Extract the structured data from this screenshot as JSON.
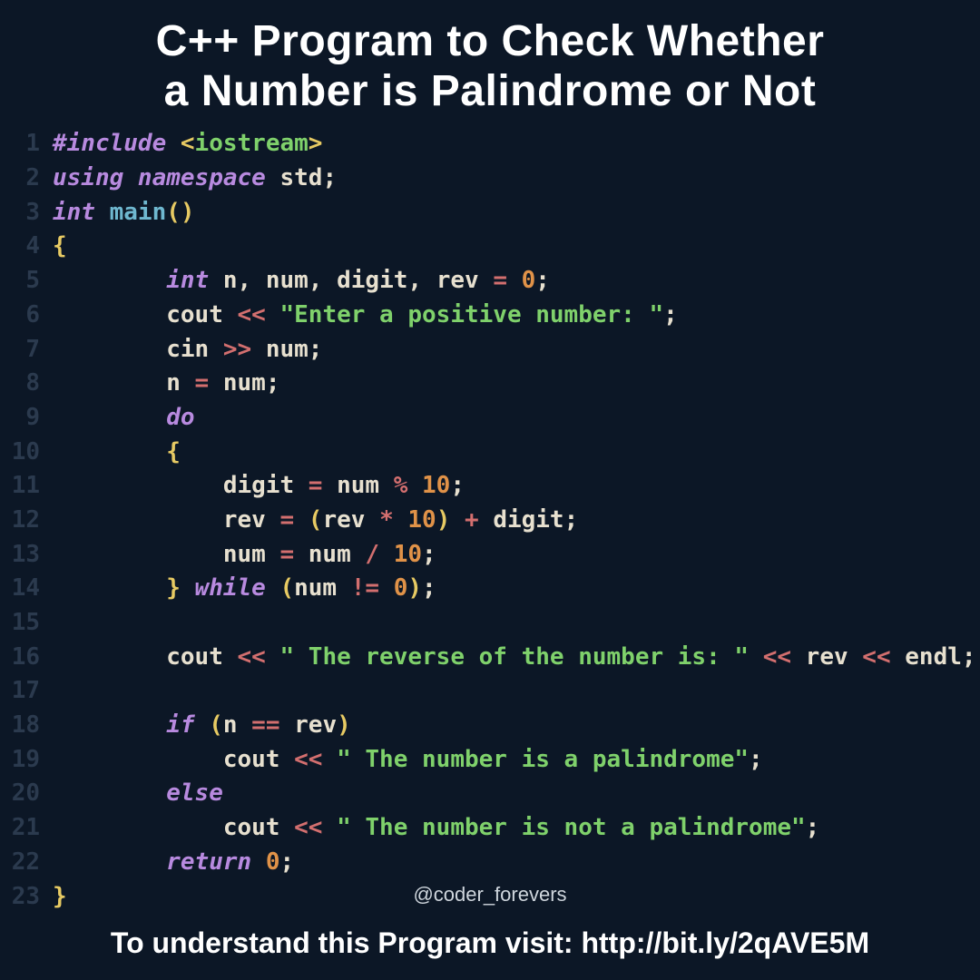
{
  "title_line1": "C++ Program to Check Whether",
  "title_line2": "a Number is Palindrome or Not",
  "watermark": "@coder_forevers",
  "footer": "To understand this Program visit: http://bit.ly/2qAVE5M",
  "code": {
    "line_numbers": [
      "1",
      "2",
      "3",
      "4",
      "5",
      "6",
      "7",
      "8",
      "9",
      "10",
      "11",
      "12",
      "13",
      "14",
      "15",
      "16",
      "17",
      "18",
      "19",
      "20",
      "21",
      "22",
      "23"
    ],
    "l1": {
      "hash_include": "#include ",
      "lt": "<",
      "hdr": "iostream",
      "gt": ">"
    },
    "l2": {
      "using": "using ",
      "namespace": "namespace ",
      "std": "std",
      "semi": ";"
    },
    "l3": {
      "int": "int ",
      "main": "main",
      "lp": "(",
      "rp": ")"
    },
    "l4": {
      "lb": "{"
    },
    "l5": {
      "indent": "        ",
      "int": "int ",
      "n": "n",
      "c1": ", ",
      "num": "num",
      "c2": ", ",
      "digit": "digit",
      "c3": ", ",
      "rev": "rev ",
      "eq": "= ",
      "zero": "0",
      "semi": ";"
    },
    "l6": {
      "indent": "        ",
      "cout": "cout ",
      "ins": "<< ",
      "str": "\"Enter a positive number: \"",
      "semi": ";"
    },
    "l7": {
      "indent": "        ",
      "cin": "cin ",
      "ext": ">> ",
      "num": "num",
      "semi": ";"
    },
    "l8": {
      "indent": "        ",
      "n": "n ",
      "eq": "= ",
      "num": "num",
      "semi": ";"
    },
    "l9": {
      "indent": "        ",
      "do": "do"
    },
    "l10": {
      "indent": "        ",
      "lb": "{"
    },
    "l11": {
      "indent": "            ",
      "digit": "digit ",
      "eq": "= ",
      "num": "num ",
      "mod": "% ",
      "ten": "10",
      "semi": ";"
    },
    "l12": {
      "indent": "            ",
      "rev": "rev ",
      "eq": "= ",
      "lp": "(",
      "rev2": "rev ",
      "mul": "* ",
      "ten": "10",
      "rp": ") ",
      "plus": "+ ",
      "digit": "digit",
      "semi": ";"
    },
    "l13": {
      "indent": "            ",
      "num": "num ",
      "eq": "= ",
      "num2": "num ",
      "div": "/ ",
      "ten": "10",
      "semi": ";"
    },
    "l14": {
      "indent": "        ",
      "rb": "} ",
      "while": "while ",
      "lp": "(",
      "num": "num ",
      "neq": "!= ",
      "zero": "0",
      "rp": ")",
      "semi": ";"
    },
    "l15": {
      "blank": " "
    },
    "l16": {
      "indent": "        ",
      "cout": "cout ",
      "ins1": "<< ",
      "str": "\" The reverse of the number is: \" ",
      "ins2": "<< ",
      "rev": "rev ",
      "ins3": "<< ",
      "endl": "endl",
      "semi": ";"
    },
    "l17": {
      "blank": " "
    },
    "l18": {
      "indent": "        ",
      "if": "if ",
      "lp": "(",
      "n": "n ",
      "eqeq": "== ",
      "rev": "rev",
      "rp": ")"
    },
    "l19": {
      "indent": "            ",
      "cout": "cout ",
      "ins": "<< ",
      "str": "\" The number is a palindrome\"",
      "semi": ";"
    },
    "l20": {
      "indent": "        ",
      "else": "else"
    },
    "l21": {
      "indent": "            ",
      "cout": "cout ",
      "ins": "<< ",
      "str": "\" The number is not a palindrome\"",
      "semi": ";"
    },
    "l22": {
      "indent": "        ",
      "return": "return ",
      "zero": "0",
      "semi": ";"
    },
    "l23": {
      "rb": "}"
    }
  }
}
